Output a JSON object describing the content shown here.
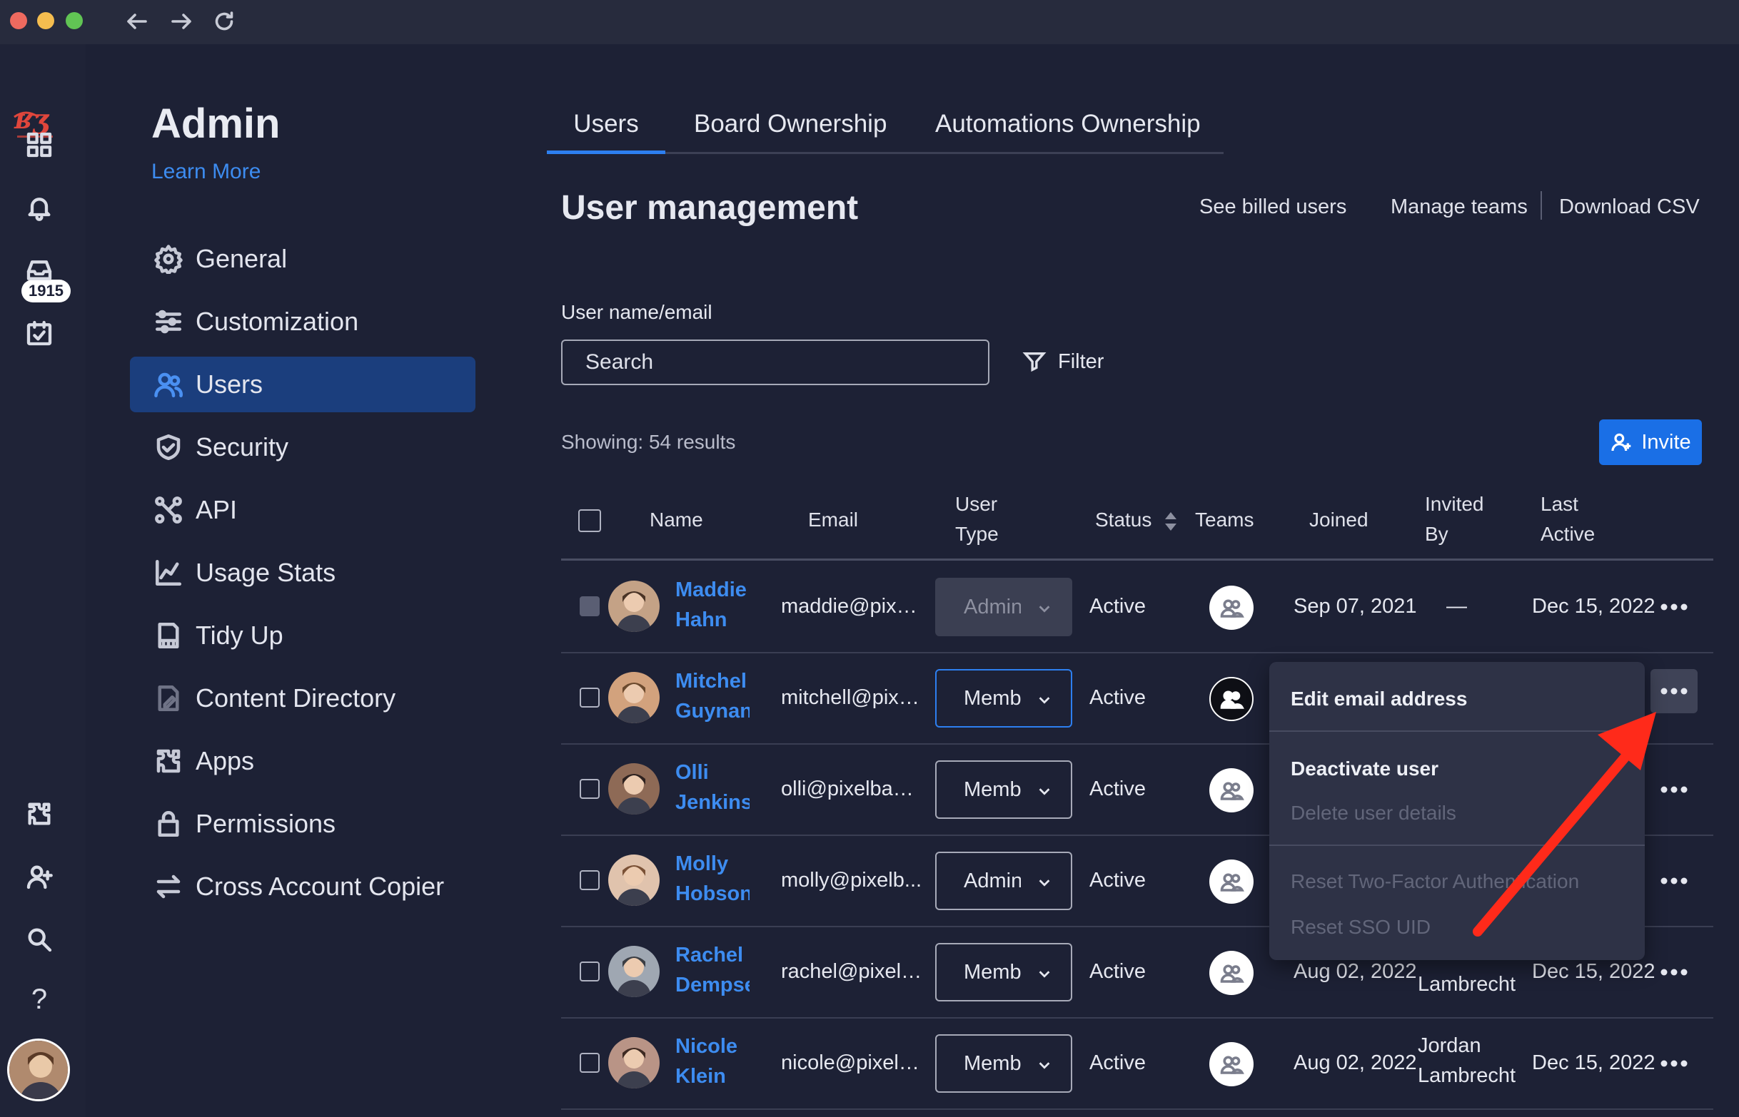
{
  "rail": {
    "badge_count": "1915",
    "icons": [
      "logo",
      "grid-icon",
      "bell-icon",
      "inbox-icon",
      "calendar-check-icon",
      "puzzle-icon",
      "add-user-icon",
      "search-icon",
      "help-icon",
      "profile-avatar"
    ],
    "help_label": "?"
  },
  "sidebar": {
    "title": "Admin",
    "learn_more": "Learn More",
    "items": [
      {
        "label": "General",
        "icon": "gear-icon"
      },
      {
        "label": "Customization",
        "icon": "sliders-icon"
      },
      {
        "label": "Users",
        "icon": "users-icon",
        "active": true
      },
      {
        "label": "Security",
        "icon": "shield-icon"
      },
      {
        "label": "API",
        "icon": "api-nodes-icon"
      },
      {
        "label": "Usage Stats",
        "icon": "chart-icon"
      },
      {
        "label": "Tidy Up",
        "icon": "receipt-icon"
      },
      {
        "label": "Content Directory",
        "icon": "document-icon"
      },
      {
        "label": "Apps",
        "icon": "puzzle-icon"
      },
      {
        "label": "Permissions",
        "icon": "lock-icon"
      },
      {
        "label": "Cross Account Copier",
        "icon": "swap-arrows-icon"
      }
    ]
  },
  "tabs": [
    {
      "label": "Users",
      "active": true
    },
    {
      "label": "Board Ownership"
    },
    {
      "label": "Automations Ownership"
    }
  ],
  "header": {
    "title": "User management",
    "see_billed": "See billed users",
    "manage_teams": "Manage teams",
    "download_csv": "Download CSV"
  },
  "search": {
    "label": "User name/email",
    "placeholder": "Search",
    "filter_label": "Filter"
  },
  "results": {
    "showing": "Showing: 54 results",
    "invite_label": "Invite"
  },
  "table": {
    "headers": {
      "name": "Name",
      "email": "Email",
      "user_type_1": "User",
      "user_type_2": "Type",
      "status": "Status",
      "teams": "Teams",
      "joined": "Joined",
      "invited_by_1": "Invited",
      "invited_by_2": "By",
      "last_active_1": "Last",
      "last_active_2": "Active"
    },
    "rows": [
      {
        "first": "Maddie",
        "last": "Hahn",
        "email": "maddie@pixel...",
        "user_type": "Admin",
        "status": "Active",
        "joined": "Sep 07, 2021",
        "invited_by_1": "—",
        "invited_by_2": "",
        "last_active": "Dec 15, 2022"
      },
      {
        "first": "Mitchel",
        "last": "Guynan",
        "email": "mitchell@pixe...",
        "user_type": "Memb",
        "status": "Active",
        "joined": "",
        "invited_by_1": "",
        "invited_by_2": "",
        "last_active": ""
      },
      {
        "first": "Olli",
        "last": "Jenkins",
        "email": "olli@pixelbake...",
        "user_type": "Memb",
        "status": "Active",
        "joined": "",
        "invited_by_1": "",
        "invited_by_2": "",
        "last_active": ""
      },
      {
        "first": "Molly",
        "last": "Hobson",
        "email": "molly@pixelb...",
        "user_type": "Admin",
        "status": "Active",
        "joined": "",
        "invited_by_1": "",
        "invited_by_2": "",
        "last_active": ""
      },
      {
        "first": "Rachel",
        "last": "Dempse",
        "email": "rachel@pixelb...",
        "user_type": "Memb",
        "status": "Active",
        "joined": "Aug 02, 2022",
        "invited_by_1": "",
        "invited_by_2": "Lambrecht",
        "last_active": "Dec 15, 2022"
      },
      {
        "first": "Nicole",
        "last": "Klein",
        "email": "nicole@pixelb...",
        "user_type": "Memb",
        "status": "Active",
        "joined": "Aug 02, 2022",
        "invited_by_1": "Jordan",
        "invited_by_2": "Lambrecht",
        "last_active": "Dec 15, 2022"
      }
    ]
  },
  "context_menu": {
    "edit_email": "Edit email address",
    "deactivate": "Deactivate user",
    "delete_details": "Delete user details",
    "reset_2fa": "Reset Two-Factor Authentication",
    "reset_sso": "Reset SSO UID"
  },
  "colors": {
    "background": "#1d2135",
    "accent": "#1a6fe6",
    "link": "#3d8cf0",
    "sidebar_active": "#1b3e7d",
    "annotation_arrow": "#ff2a1a"
  }
}
